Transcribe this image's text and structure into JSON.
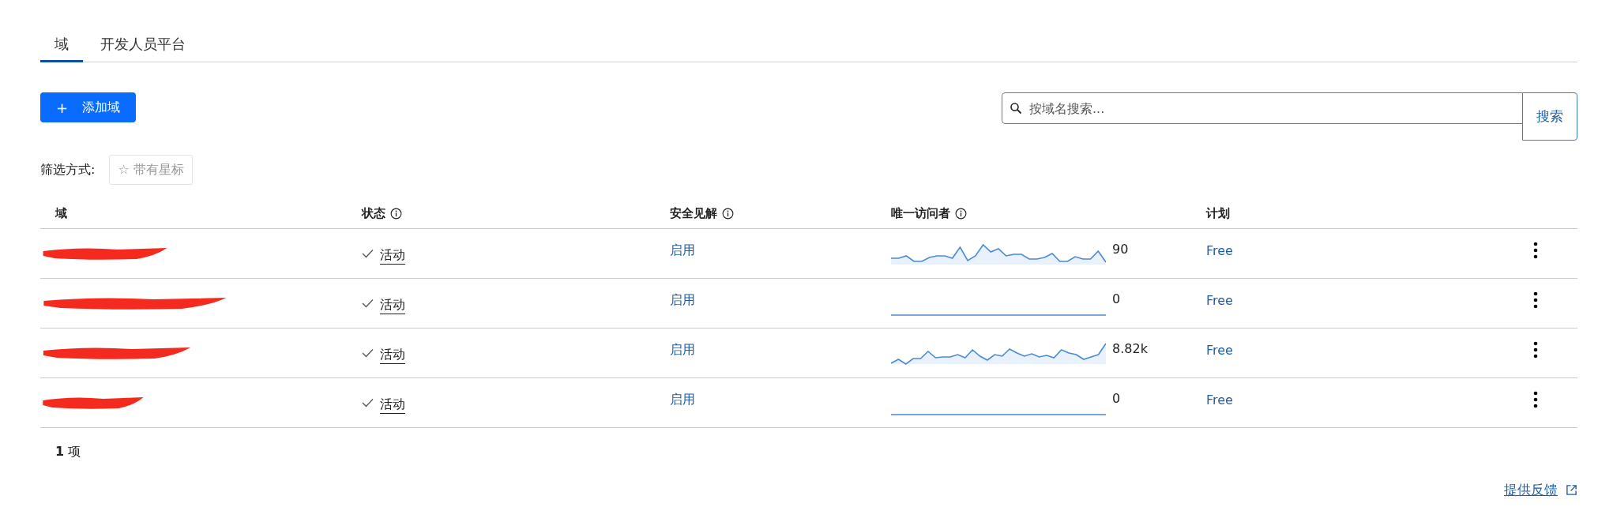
{
  "tabs": [
    {
      "label": "域",
      "selected": true
    },
    {
      "label": "开发人员平台",
      "selected": false
    }
  ],
  "add_button": {
    "icon": "+",
    "label": "添加域"
  },
  "search": {
    "placeholder": "按域名搜索...",
    "button": "搜索"
  },
  "filter": {
    "label": "筛选方式:",
    "chip": {
      "icon": "☆",
      "label": "带有星标",
      "selected": false
    }
  },
  "table": {
    "columns": [
      {
        "label": "域",
        "info": false
      },
      {
        "label": "状态",
        "info": true
      },
      {
        "label": "安全见解",
        "info": true
      },
      {
        "label": "唯一访问者",
        "info": true
      },
      {
        "label": "计划",
        "info": false
      }
    ],
    "rows": [
      {
        "domain": {
          "kind": "redacted"
        },
        "status": "活动",
        "insights": "启用",
        "kind": "wave",
        "visitors": "90",
        "plan": "Free"
      },
      {
        "domain": {
          "kind": "redacted"
        },
        "status": "活动",
        "insights": "启用",
        "kind": "flat",
        "visitors": "0",
        "plan": "Free"
      },
      {
        "domain": {
          "kind": "redacted"
        },
        "status": "活动",
        "insights": "启用",
        "kind": "wave",
        "visitors": "8.82k",
        "plan": "Free"
      },
      {
        "domain": {
          "kind": "redacted"
        },
        "status": "活动",
        "insights": "启用",
        "kind": "flat",
        "visitors": "0",
        "plan": "Free"
      }
    ]
  },
  "count": {
    "number": "1",
    "unit": "项"
  },
  "feedback_link": "提供反馈"
}
